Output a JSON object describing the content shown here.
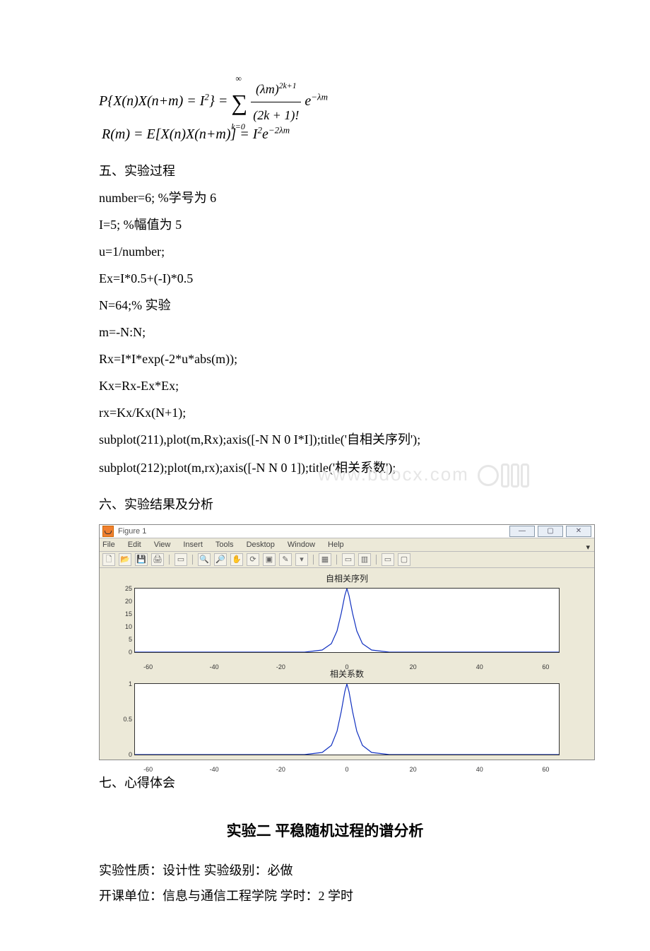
{
  "formula1_lhs": "P{X(n)X(n+m) = I",
  "formula1_sup2": "2",
  "formula1_rhs_eq": "} = ",
  "formula1_sigma_top": "∞",
  "formula1_sigma_bot": "k=0",
  "formula1_frac_num": "(λm)",
  "formula1_frac_num_sup": "2k+1",
  "formula1_frac_den": "(2k + 1)!",
  "formula1_tail": "e",
  "formula1_tail_sup": "−λm",
  "formula2_lhs": "R(m) = E[X(n)X(n+m)] = I",
  "formula2_sup2": "2",
  "formula2_e": "e",
  "formula2_e_sup": "−2λm",
  "sec5": "五、实验过程",
  "code1": "number=6; %学号为 6",
  "code2": "I=5; %幅值为 5",
  "code3": "u=1/number;",
  "code4": "Ex=I*0.5+(-I)*0.5",
  "code5": "N=64;% 实验",
  "code6": "m=-N:N;",
  "code7": "Rx=I*I*exp(-2*u*abs(m));",
  "code8": "Kx=Rx-Ex*Ex;",
  "code9": "rx=Kx/Kx(N+1);",
  "code10": "subplot(211),plot(m,Rx);axis([-N N 0 I*I]);title('自相关序列');",
  "code11": "subplot(212);plot(m,rx);axis([-N N 0 1]);title('相关系数');",
  "sec6": "六、实验结果及分析",
  "window": {
    "title": "Figure 1",
    "menus": [
      "File",
      "Edit",
      "View",
      "Insert",
      "Tools",
      "Desktop",
      "Window",
      "Help"
    ],
    "plot1_title": "自相关序列",
    "plot2_title": "相关系数"
  },
  "chart_data": [
    {
      "type": "line",
      "title": "自相关序列",
      "xlabel": "",
      "ylabel": "",
      "xlim": [
        -64,
        64
      ],
      "ylim": [
        0,
        25
      ],
      "xticks": [
        -60,
        -40,
        -20,
        0,
        20,
        40,
        60
      ],
      "yticks": [
        0,
        5,
        10,
        15,
        20,
        25
      ],
      "function": "Rx(m) = 25 * exp(-|m|/3)",
      "series": [
        {
          "name": "Rx",
          "x": [
            -60,
            -40,
            -20,
            -10,
            -5,
            -2,
            -1,
            0,
            1,
            2,
            5,
            10,
            20,
            40,
            60
          ],
          "y": [
            0.0,
            0.0,
            0.03,
            0.89,
            4.72,
            12.83,
            17.92,
            25,
            17.92,
            12.83,
            4.72,
            0.89,
            0.03,
            0.0,
            0.0
          ]
        }
      ]
    },
    {
      "type": "line",
      "title": "相关系数",
      "xlabel": "",
      "ylabel": "",
      "xlim": [
        -64,
        64
      ],
      "ylim": [
        0,
        1
      ],
      "xticks": [
        -60,
        -40,
        -20,
        0,
        20,
        40,
        60
      ],
      "yticks": [
        0,
        0.5,
        1
      ],
      "function": "rx(m) = exp(-|m|/3)",
      "series": [
        {
          "name": "rx",
          "x": [
            -60,
            -40,
            -20,
            -10,
            -5,
            -2,
            -1,
            0,
            1,
            2,
            5,
            10,
            20,
            40,
            60
          ],
          "y": [
            0.0,
            0.0,
            0.001,
            0.036,
            0.189,
            0.513,
            0.717,
            1.0,
            0.717,
            0.513,
            0.189,
            0.036,
            0.001,
            0.0,
            0.0
          ]
        }
      ]
    }
  ],
  "sec7": "七、心得体会",
  "heading2": "实验二 平稳随机过程的谱分析",
  "line_a": "实验性质：设计性 实验级别：必做",
  "line_b": "开课单位：信息与通信工程学院 学时：2 学时",
  "wm_text": "www.bdocx.com"
}
